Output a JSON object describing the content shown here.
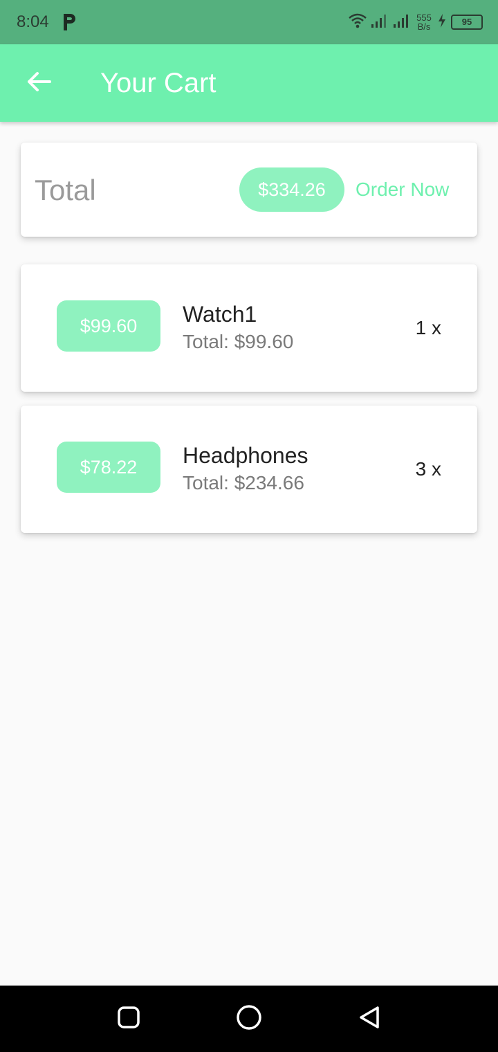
{
  "status_bar": {
    "time": "8:04",
    "net_speed_value": "555",
    "net_speed_unit": "B/s",
    "battery": "95",
    "icons": [
      "p-app-icon",
      "wifi-icon",
      "signal-icon",
      "signal-icon",
      "charging-icon",
      "battery-icon"
    ]
  },
  "app_bar": {
    "title": "Your Cart",
    "back_icon": "arrow-left-icon",
    "background": "#6ef0ae"
  },
  "summary": {
    "label": "Total",
    "amount": "$334.26",
    "order_button": "Order Now",
    "accent": "#6ef0ae",
    "chip_color": "#8ff2bf"
  },
  "items": [
    {
      "price": "$99.60",
      "name": "Watch1",
      "total": "Total: $99.60",
      "quantity": "1 x"
    },
    {
      "price": "$78.22",
      "name": "Headphones",
      "total": "Total: $234.66",
      "quantity": "3 x"
    }
  ],
  "nav_bar": {
    "icons": [
      "recents-square-icon",
      "home-circle-icon",
      "back-triangle-icon"
    ]
  }
}
